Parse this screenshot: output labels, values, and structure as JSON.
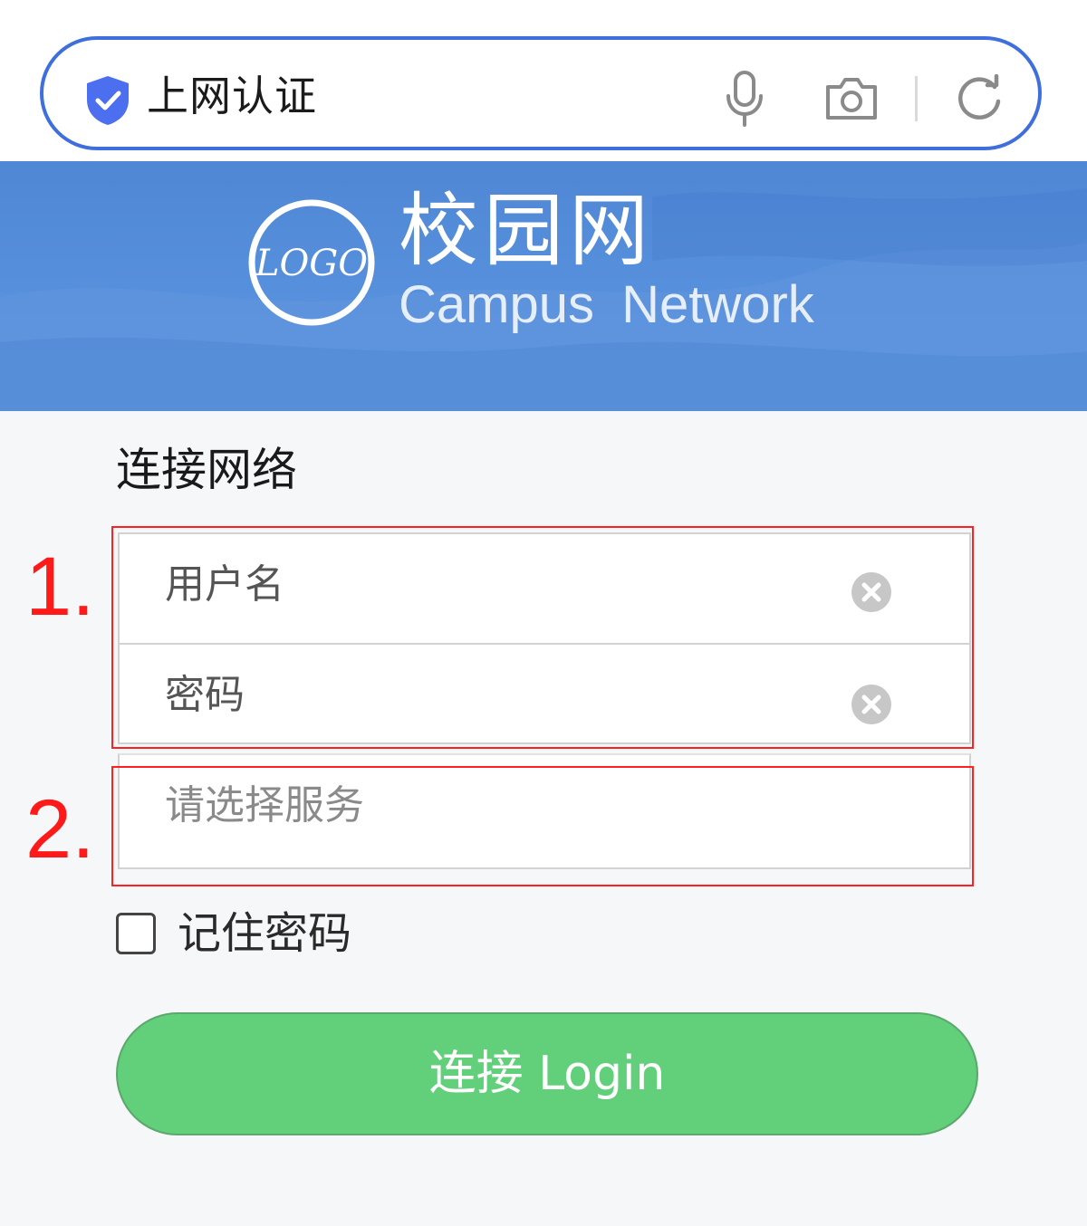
{
  "browser": {
    "title": "上网认证",
    "icons": [
      "shield-check-icon",
      "microphone-icon",
      "camera-icon",
      "reload-icon"
    ],
    "accent_color": "#3f6fdc"
  },
  "banner": {
    "logo_text": "LOGO",
    "site_name_cn": "校园网",
    "site_name_en": "Campus Network",
    "background_color": "#5790dc"
  },
  "form": {
    "title": "连接网络",
    "username_placeholder": "用户名",
    "password_placeholder": "密码",
    "service_placeholder": "请选择服务",
    "remember_label": "记住密码",
    "remember_checked": false,
    "login_label": "连接 Login",
    "login_color": "#62cf7a"
  },
  "annotations": {
    "marker_1": "1.",
    "marker_2": "2.",
    "color": "#ff2020"
  }
}
